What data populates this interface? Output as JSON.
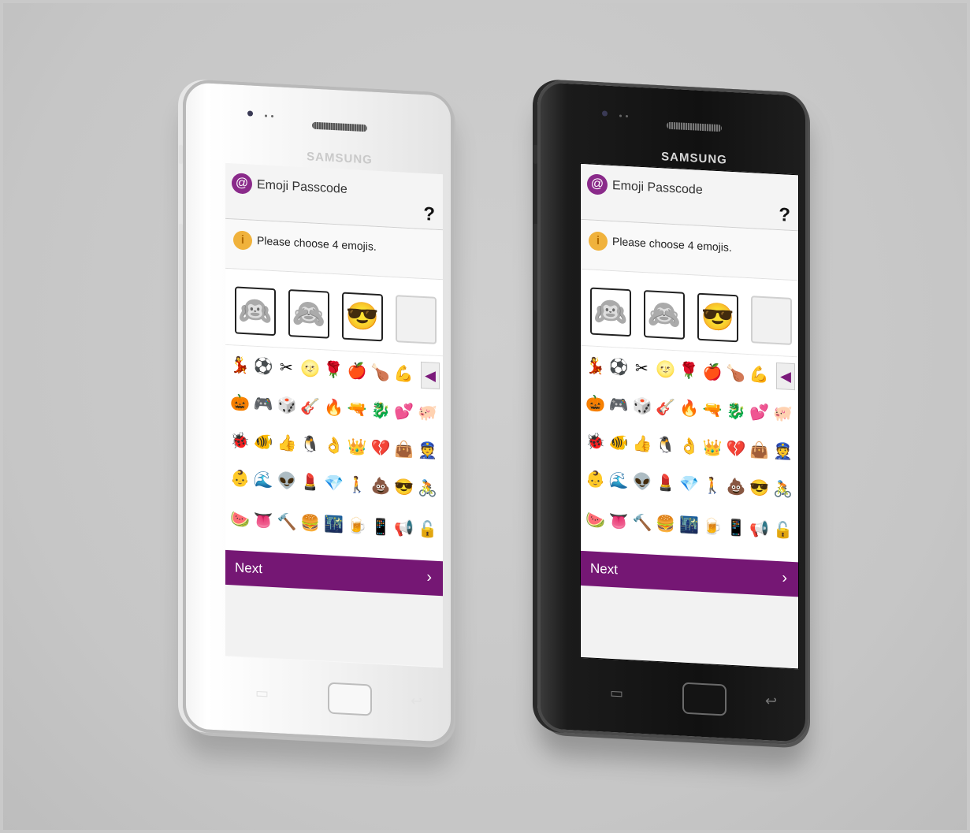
{
  "brand": "SAMSUNG",
  "app": {
    "logo_glyph": "@",
    "title": "Emoji Passcode",
    "help_label": "?"
  },
  "hint": {
    "icon_glyph": "i",
    "text": "Please choose 4 emojis."
  },
  "selected_slots": [
    "🙉",
    "🙈",
    "😎",
    ""
  ],
  "emoji_grid": [
    [
      "💃",
      "⚽",
      "✂",
      "🌝",
      "🌹",
      "🍎",
      "🍗",
      "💪"
    ],
    [
      "🎃",
      "🎮",
      "🎲",
      "🎸",
      "🔥",
      "🔫",
      "🐉",
      "💕",
      "🐖"
    ],
    [
      "🐞",
      "🐠",
      "👍",
      "🐧",
      "👌",
      "👑",
      "💔",
      "👜",
      "👮"
    ],
    [
      "👶",
      "🌊",
      "👽",
      "💄",
      "💎",
      "🚶",
      "💩",
      "😎",
      "🚴"
    ],
    [
      "🍉",
      "👅",
      "🔨",
      "🍔",
      "🌃",
      "🍺",
      "📱",
      "📢",
      "🔓"
    ]
  ],
  "backspace_glyph": "◀",
  "next": {
    "label": "Next",
    "chevron": "›"
  },
  "nav_keys": {
    "menu": "▭",
    "back": "↩"
  },
  "colors": {
    "accent": "#751774",
    "info": "#f0b23c",
    "background": "#c9c9c9"
  }
}
